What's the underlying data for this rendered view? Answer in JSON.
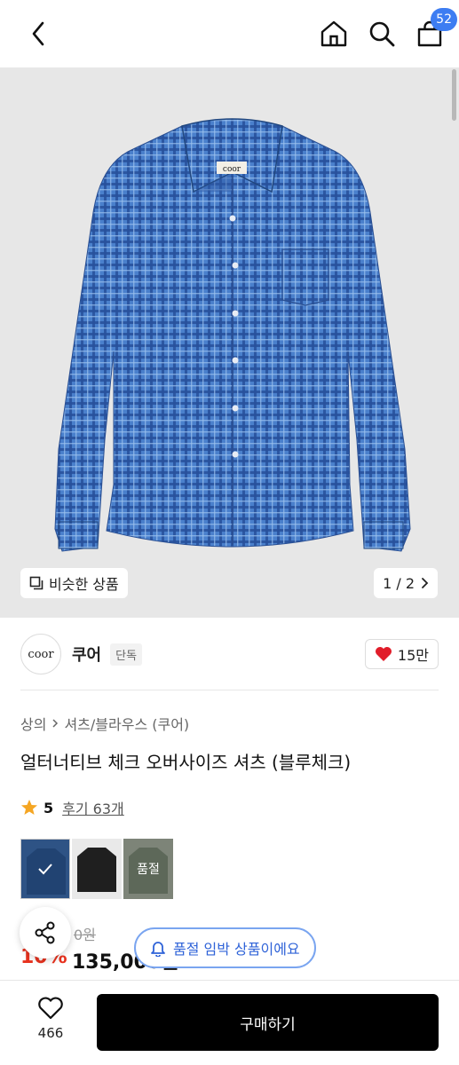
{
  "header": {
    "cart_count": "52"
  },
  "hero": {
    "similar_label": "비슷한 상품",
    "pager": "1 / 2",
    "shirt_tag": "coor"
  },
  "brand": {
    "logo": "coor",
    "name": "쿠어",
    "tag": "단독",
    "likes": "15만"
  },
  "breadcrumb": {
    "category": "상의",
    "sub": "셔츠/블라우스 (쿠어)"
  },
  "product": {
    "title": "얼터너티브 체크 오버사이즈 셔츠 (블루체크)",
    "rating": "5",
    "reviews": "후기 63개"
  },
  "swatches": {
    "soldout_label": "품절"
  },
  "price": {
    "original": "0원",
    "discount": "10%",
    "current": "135,000원"
  },
  "soldout_notice": "품절 임박 상품이에요",
  "bottom": {
    "wish_count": "466",
    "buy_label": "구매하기"
  },
  "colors": {
    "accent": "#3d7df2",
    "discount": "#e8321e",
    "shirt": "#3b6fc0"
  }
}
